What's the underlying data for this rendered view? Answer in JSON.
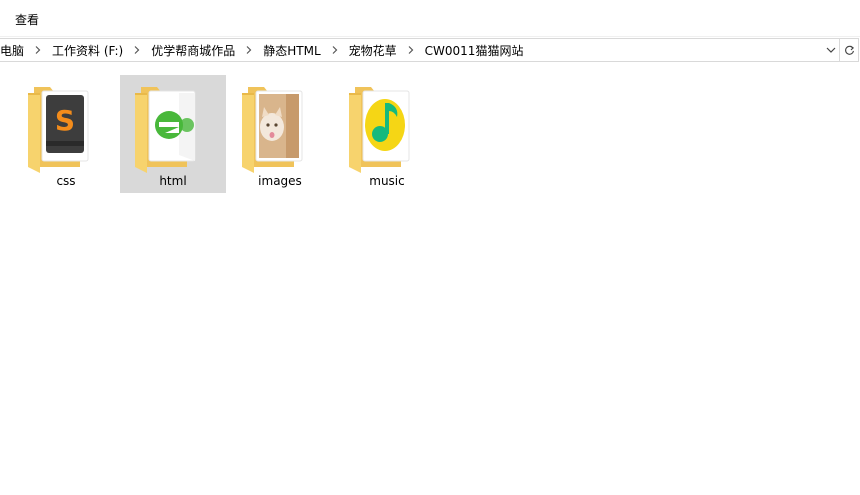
{
  "ribbon": {
    "tab_label": "查看"
  },
  "address": {
    "crumbs": [
      "电脑",
      "工作资料 (F:)",
      "优学帮商城作品",
      "静态HTML",
      "宠物花草",
      "CW0011猫猫网站"
    ]
  },
  "items": [
    {
      "name": "css",
      "icon": "sublime-text-icon",
      "selected": false
    },
    {
      "name": "html",
      "icon": "browser-e-icon",
      "selected": true
    },
    {
      "name": "images",
      "icon": "cat-photo-icon",
      "selected": false
    },
    {
      "name": "music",
      "icon": "qq-music-icon",
      "selected": false
    }
  ],
  "colors": {
    "folder": "#f7d36d",
    "folder_dark": "#e9b949",
    "selected_bg": "#d9d9d9",
    "sublime_orange": "#f38c1b",
    "browser_green": "#49b83b",
    "music_yellow": "#f5d615",
    "music_green": "#16b97d"
  }
}
